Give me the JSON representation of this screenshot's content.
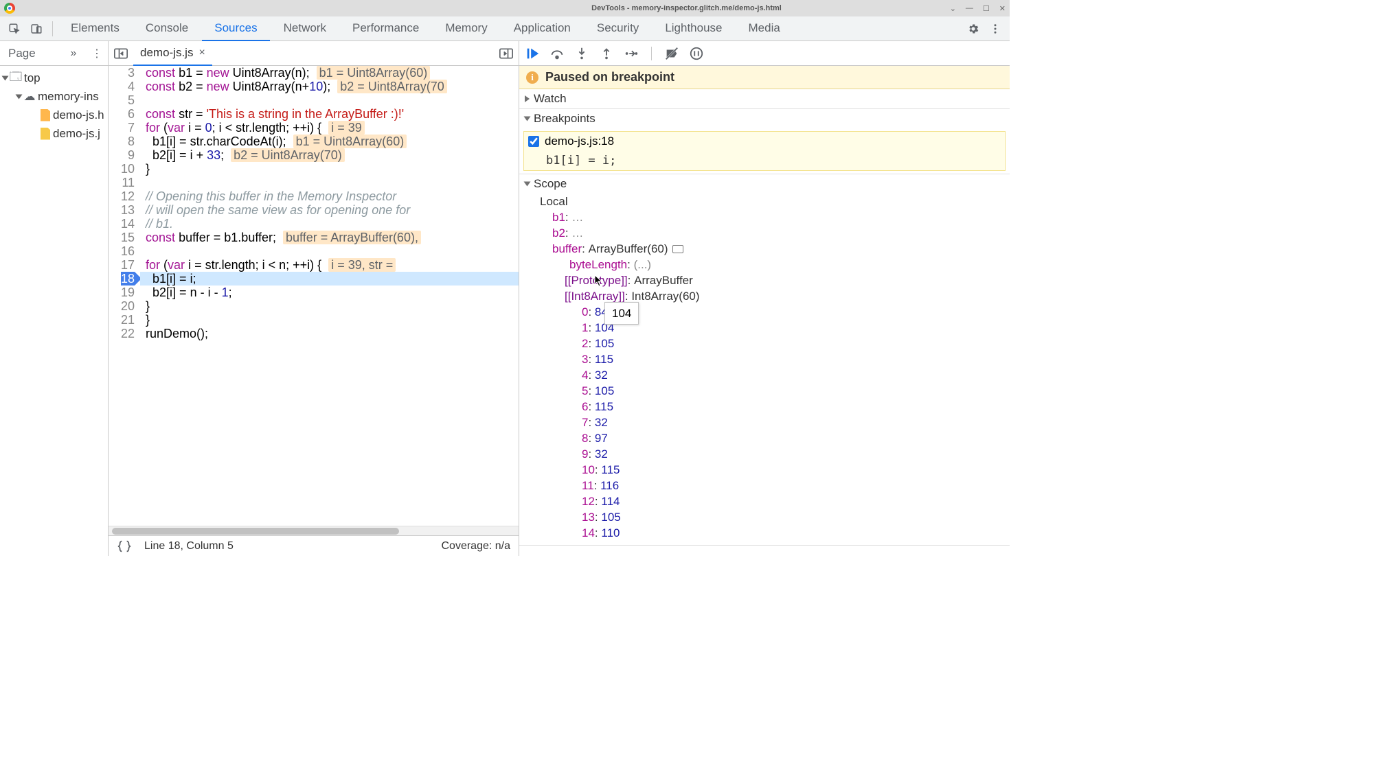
{
  "window": {
    "title": "DevTools - memory-inspector.glitch.me/demo-js.html"
  },
  "tabs": {
    "items": [
      "Elements",
      "Console",
      "Sources",
      "Network",
      "Performance",
      "Memory",
      "Application",
      "Security",
      "Lighthouse",
      "Media"
    ],
    "active": "Sources"
  },
  "sidebar": {
    "tab": "Page",
    "tree": {
      "top": "top",
      "domain": "memory-ins",
      "files": [
        "demo-js.h",
        "demo-js.j"
      ]
    }
  },
  "editor": {
    "filename": "demo-js.js",
    "lines": [
      {
        "n": 3,
        "code": "const b1 = new Uint8Array(n);",
        "hint": "b1 = Uint8Array(60)"
      },
      {
        "n": 4,
        "code": "const b2 = new Uint8Array(n+10);",
        "hint": "b2 = Uint8Array(70"
      },
      {
        "n": 5,
        "code": ""
      },
      {
        "n": 6,
        "code": "const str = 'This is a string in the ArrayBuffer :)!'"
      },
      {
        "n": 7,
        "code": "for (var i = 0; i < str.length; ++i) {",
        "hint": "i = 39"
      },
      {
        "n": 8,
        "code": "  b1[i] = str.charCodeAt(i);",
        "hint": "b1 = Uint8Array(60)"
      },
      {
        "n": 9,
        "code": "  b2[i] = i + 33;",
        "hint": "b2 = Uint8Array(70)"
      },
      {
        "n": 10,
        "code": "}"
      },
      {
        "n": 11,
        "code": ""
      },
      {
        "n": 12,
        "code": "// Opening this buffer in the Memory Inspector"
      },
      {
        "n": 13,
        "code": "// will open the same view as for opening one for"
      },
      {
        "n": 14,
        "code": "// b1."
      },
      {
        "n": 15,
        "code": "const buffer = b1.buffer;",
        "hint": "buffer = ArrayBuffer(60),"
      },
      {
        "n": 16,
        "code": ""
      },
      {
        "n": 17,
        "code": "for (var i = str.length; i < n; ++i) {",
        "hint": "i = 39, str ="
      },
      {
        "n": 18,
        "code": "  b1[i] = i;",
        "current": true
      },
      {
        "n": 19,
        "code": "  b2[i] = n - i - 1;"
      },
      {
        "n": 20,
        "code": "}"
      },
      {
        "n": 21,
        "code": "}"
      },
      {
        "n": 22,
        "code": "runDemo();"
      }
    ]
  },
  "status": {
    "pos": "Line 18, Column 5",
    "coverage": "Coverage: n/a"
  },
  "debugger": {
    "banner": "Paused on breakpoint",
    "sections": {
      "watch": "Watch",
      "breakpoints": "Breakpoints",
      "scope": "Scope"
    },
    "breakpoint": {
      "file": "demo-js.js:18",
      "code": "b1[i] = i;"
    },
    "scope": {
      "local": "Local",
      "b1": "…",
      "b2": "…",
      "buffer": {
        "name": "buffer",
        "type": "ArrayBuffer(60)"
      },
      "byteLength": "(...)",
      "prototype": {
        "label": "[[Prototype]]",
        "val": "ArrayBuffer"
      },
      "int8": {
        "label": "[[Int8Array]]",
        "val": "Int8Array(60)"
      },
      "array": [
        {
          "i": 0,
          "v": 84
        },
        {
          "i": 1,
          "v": 104
        },
        {
          "i": 2,
          "v": 105
        },
        {
          "i": 3,
          "v": 115
        },
        {
          "i": 4,
          "v": 32
        },
        {
          "i": 5,
          "v": 105
        },
        {
          "i": 6,
          "v": 115
        },
        {
          "i": 7,
          "v": 32
        },
        {
          "i": 8,
          "v": 97
        },
        {
          "i": 9,
          "v": 32
        },
        {
          "i": 10,
          "v": 115
        },
        {
          "i": 11,
          "v": 116
        },
        {
          "i": 12,
          "v": 114
        },
        {
          "i": 13,
          "v": 105
        },
        {
          "i": 14,
          "v": 110
        }
      ]
    },
    "tooltip": "104"
  }
}
